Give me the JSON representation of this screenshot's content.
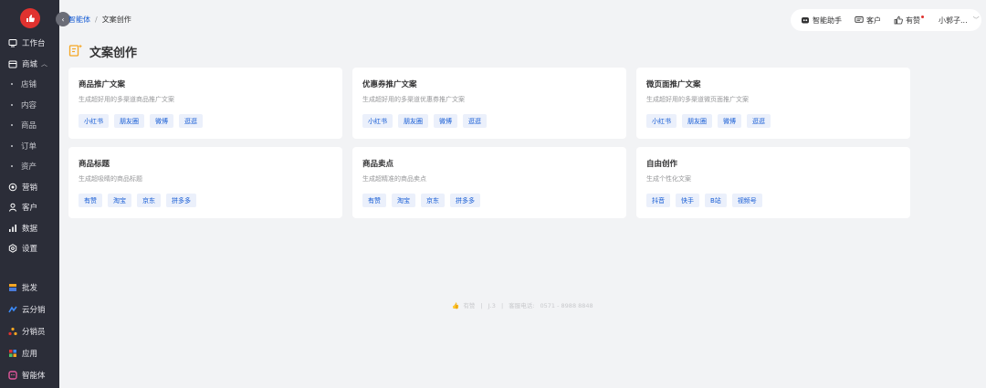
{
  "sidebar": {
    "logo_icon": "brand-logo-icon",
    "items": [
      {
        "label": "工作台",
        "icon": "workbench-icon"
      },
      {
        "label": "商城",
        "icon": "store-icon",
        "expanded": true
      },
      {
        "label": "店铺",
        "sub": true
      },
      {
        "label": "内容",
        "sub": true
      },
      {
        "label": "商品",
        "sub": true
      },
      {
        "label": "订单",
        "sub": true
      },
      {
        "label": "资产",
        "sub": true
      },
      {
        "label": "营销",
        "icon": "marketing-icon"
      },
      {
        "label": "客户",
        "icon": "customer-icon"
      },
      {
        "label": "数据",
        "icon": "data-icon"
      },
      {
        "label": "设置",
        "icon": "settings-icon"
      }
    ],
    "bottom_items": [
      {
        "label": "批发",
        "icon": "wholesale-icon"
      },
      {
        "label": "云分销",
        "icon": "cloud-distribution-icon"
      },
      {
        "label": "分销员",
        "icon": "distributor-icon"
      },
      {
        "label": "应用",
        "icon": "apps-icon"
      },
      {
        "label": "智能体",
        "icon": "agent-icon"
      }
    ]
  },
  "breadcrumb": {
    "parent": "智能体",
    "separator": "/",
    "current": "文案创作"
  },
  "topbar": {
    "assistant": "智能助手",
    "customer": "客户",
    "youzan": "有赞",
    "user": "小郭子..."
  },
  "page": {
    "title": "文案创作"
  },
  "cards": [
    {
      "title": "商品推广文案",
      "desc": "生成超好用的多渠道商品推广文案",
      "tags": [
        "小红书",
        "朋友圈",
        "微博",
        "逛逛"
      ]
    },
    {
      "title": "优惠券推广文案",
      "desc": "生成超好用的多渠道优惠券推广文案",
      "tags": [
        "小红书",
        "朋友圈",
        "微博",
        "逛逛"
      ]
    },
    {
      "title": "微页面推广文案",
      "desc": "生成超好用的多渠道微页面推广文案",
      "tags": [
        "小红书",
        "朋友圈",
        "微博",
        "逛逛"
      ]
    },
    {
      "title": "商品标题",
      "desc": "生成超吸睛的商品标题",
      "tags": [
        "有赞",
        "淘宝",
        "京东",
        "拼多多"
      ]
    },
    {
      "title": "商品卖点",
      "desc": "生成超精准的商品卖点",
      "tags": [
        "有赞",
        "淘宝",
        "京东",
        "拼多多"
      ]
    },
    {
      "title": "自由创作",
      "desc": "生成个性化文案",
      "tags": [
        "抖音",
        "快手",
        "B站",
        "视频号"
      ]
    }
  ],
  "footer": {
    "brand": "有赞",
    "version": "J.3",
    "phone_label": "客服电话:",
    "phone": "0571 - 8988 8848"
  },
  "colors": {
    "sidebar_bg": "#2b2d38",
    "accent": "#155bd4",
    "tag_bg": "#ebf0fb",
    "logo_red": "#e0322f"
  }
}
